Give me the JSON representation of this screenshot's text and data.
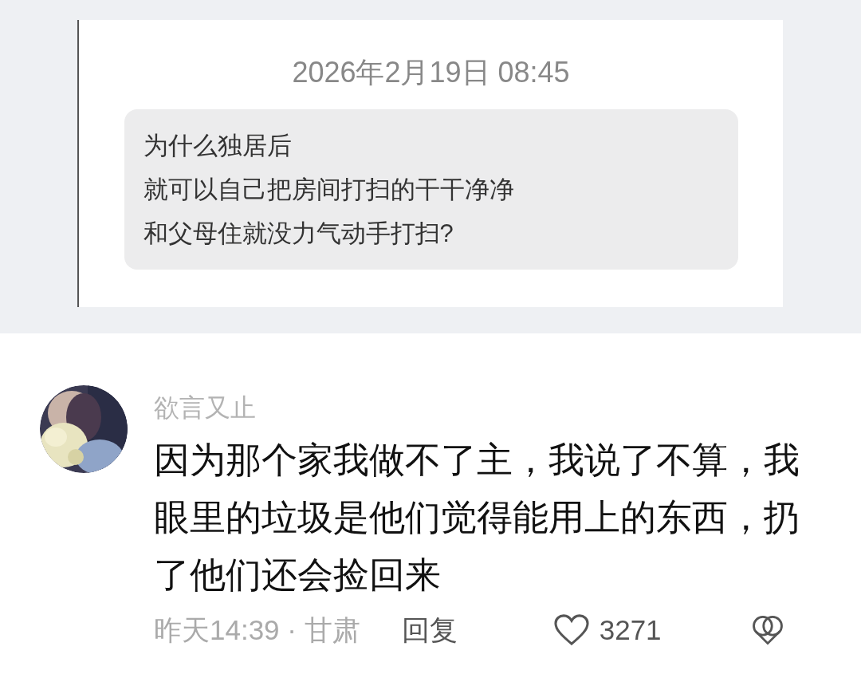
{
  "screenshot": {
    "timestamp": "2026年2月19日 08:45",
    "message_lines": [
      "为什么独居后",
      "就可以自己把房间打扫的干干净净",
      "和父母住就没力气动手打扫?"
    ]
  },
  "comment": {
    "author": "欲言又止",
    "text": "因为那个家我做不了主，我说了不算，我眼里的垃圾是他们觉得能用上的东西，扔了他们还会捡回来",
    "meta": "昨天14:39 · 甘肃",
    "reply": "回复",
    "likes": "3271"
  }
}
